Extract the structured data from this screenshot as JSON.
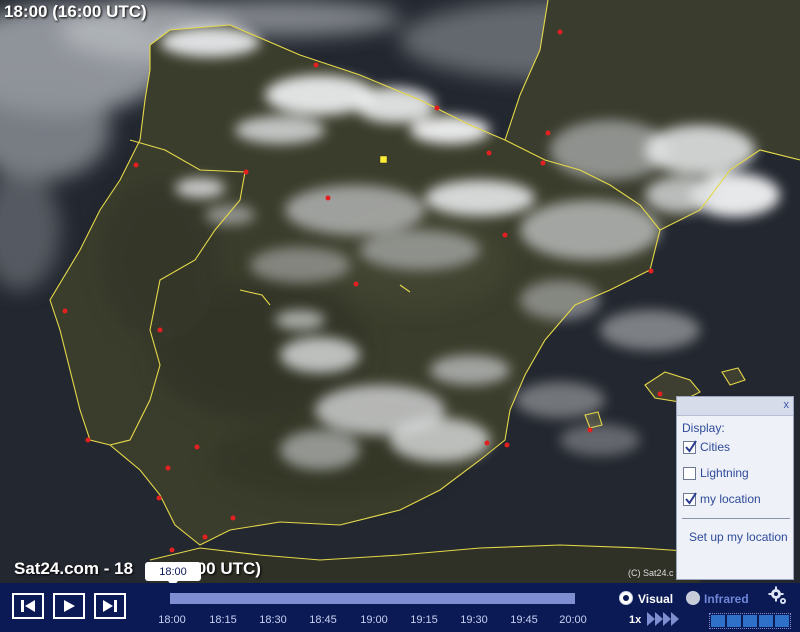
{
  "top_time": "18:00 (16:00 UTC)",
  "caption": {
    "prefix": "Sat24.com - 18",
    "suffix": ":00 UTC)"
  },
  "copyright": "(C) Sat24.c",
  "display_panel": {
    "close_label": "x",
    "heading": "Display:",
    "options": [
      {
        "label": "Cities",
        "checked": true
      },
      {
        "label": "Lightning",
        "checked": false
      },
      {
        "label": "my location",
        "checked": true
      }
    ],
    "setup_link": "Set up my location"
  },
  "timeline": {
    "current_time": "18:00",
    "ticks": [
      "18:00",
      "18:15",
      "18:30",
      "18:45",
      "19:00",
      "19:15",
      "19:30",
      "19:45",
      "20:00"
    ]
  },
  "view_modes": [
    {
      "label": "Visual",
      "selected": true
    },
    {
      "label": "Infrared",
      "selected": false
    }
  ],
  "speed": "1x",
  "icons": {
    "first_frame": "skip-to-start-icon",
    "play": "play-icon",
    "last_frame": "skip-to-end-icon",
    "settings": "gear-icon",
    "speed": "fast-forward-icon"
  },
  "colors": {
    "coastline": "#e4d84a",
    "city_marker": "#e32020",
    "my_location_marker": "#ffee33",
    "toolbar_bg": "#0b1a55",
    "panel_text": "#2f4b9a"
  }
}
